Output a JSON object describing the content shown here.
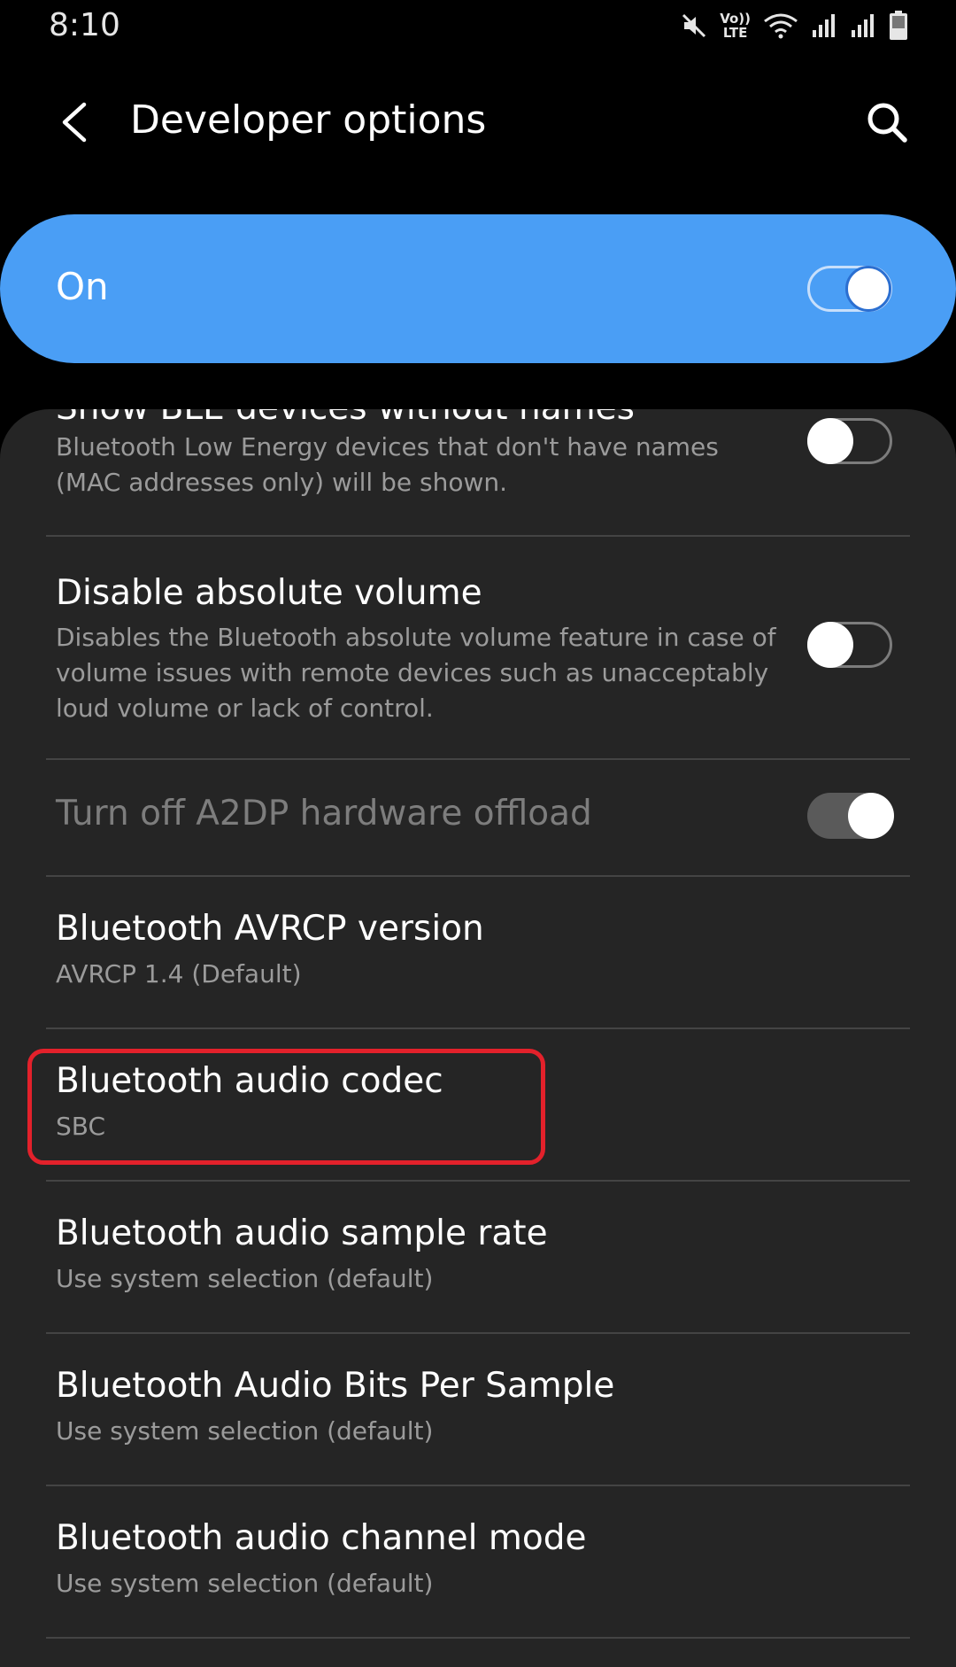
{
  "status_bar": {
    "time": "8:10",
    "volte_top": "Vo))",
    "volte_bottom": "LTE",
    "icons": [
      "mute-icon",
      "volte-icon",
      "wifi-icon",
      "signal-icon",
      "signal-icon",
      "battery-icon"
    ]
  },
  "header": {
    "title": "Developer options",
    "back_icon": "back-arrow-icon",
    "search_icon": "search-icon"
  },
  "master_switch": {
    "label": "On",
    "checked": true,
    "accent_color": "#4a9ef5"
  },
  "items": [
    {
      "title": "Show BLE devices without names",
      "subtitle": "Bluetooth Low Energy devices that don't have names (MAC addresses only) will be shown.",
      "toggle": false
    },
    {
      "title": "Disable absolute volume",
      "subtitle": "Disables the Bluetooth absolute volume feature in case of volume issues with remote devices such as unacceptably loud volume or lack of control.",
      "toggle": false
    },
    {
      "title": "Turn off A2DP hardware offload",
      "toggle": true,
      "disabled": true
    },
    {
      "title": "Bluetooth AVRCP version",
      "subtitle": "AVRCP 1.4 (Default)"
    },
    {
      "title": "Bluetooth audio codec",
      "subtitle": "SBC",
      "highlighted": true
    },
    {
      "title": "Bluetooth audio sample rate",
      "subtitle": "Use system selection (default)"
    },
    {
      "title": "Bluetooth Audio Bits Per Sample",
      "subtitle": "Use system selection (default)"
    },
    {
      "title": "Bluetooth audio channel mode",
      "subtitle": "Use system selection (default)"
    }
  ],
  "highlight_color": "#e3212b"
}
